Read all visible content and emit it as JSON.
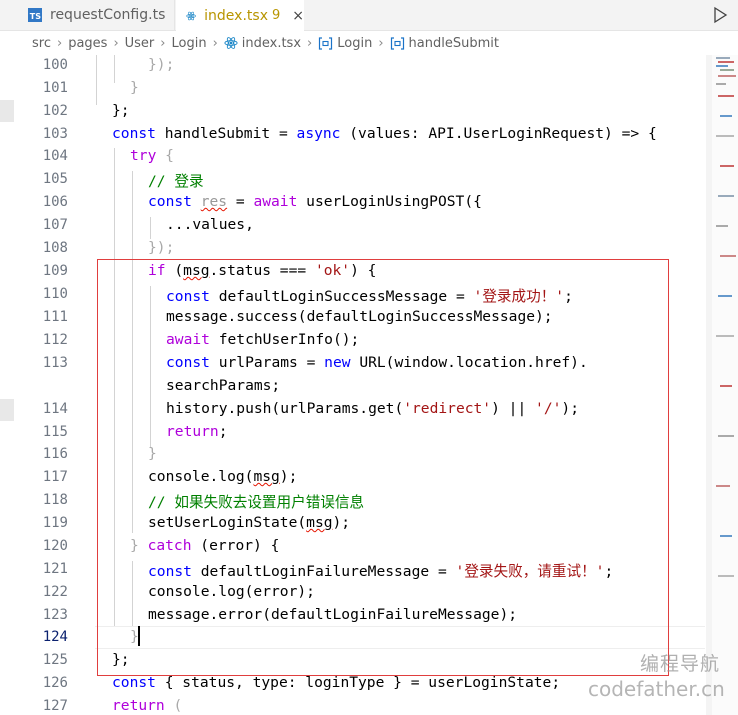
{
  "tabs": [
    {
      "label": "requestConfig.ts",
      "icon": "typescript-file-icon",
      "badge_text": "TS"
    },
    {
      "label": "index.tsx",
      "icon": "react-file-icon",
      "problem_count": "9",
      "close": "×"
    }
  ],
  "breadcrumb": [
    "src",
    "pages",
    "User",
    "Login",
    "index.tsx",
    "Login",
    "handleSubmit"
  ],
  "gutter": [
    "100",
    "101",
    "102",
    "103",
    "104",
    "105",
    "106",
    "107",
    "108",
    "109",
    "110",
    "111",
    "112",
    "113",
    "",
    "114",
    "115",
    "116",
    "117",
    "118",
    "119",
    "120",
    "121",
    "122",
    "123",
    "124",
    "125",
    "126",
    "127"
  ],
  "active_line": "124",
  "code": {
    "l100": "});",
    "l101": "}",
    "l102": "};",
    "l103_a": "const",
    "l103_b": " handleSubmit = ",
    "l103_c": "async",
    "l103_d": " (values: API.UserLoginRequest) => {",
    "l104_a": "try",
    "l104_b": " {",
    "l105": "// 登录",
    "l106_a": "const",
    "l106_b": "res",
    "l106_c": " = ",
    "l106_d": "await",
    "l106_e": " userLoginUsingPOST({",
    "l107": "...values,",
    "l108": "});",
    "l109_a": "if",
    "l109_b": " (",
    "l109_c": "msg",
    "l109_d": ".status === ",
    "l109_e": "'ok'",
    "l109_f": ") {",
    "l110_a": "const",
    "l110_b": " defaultLoginSuccessMessage = ",
    "l110_c": "'登录成功！'",
    "l110_d": ";",
    "l111": "message.success(defaultLoginSuccessMessage);",
    "l112_a": "await",
    "l112_b": " fetchUserInfo();",
    "l113_a": "const",
    "l113_b": " urlParams = ",
    "l113_c": "new",
    "l113_d": " URL(window.location.href).",
    "l113w": "searchParams;",
    "l114_a": "history.push(urlParams.get(",
    "l114_b": "'redirect'",
    "l114_c": ") || ",
    "l114_d": "'/'",
    "l114_e": ");",
    "l115_a": "return",
    "l115_b": ";",
    "l116": "}",
    "l117_a": "console.log(",
    "l117_b": "msg",
    "l117_c": ");",
    "l118": "// 如果失败去设置用户错误信息",
    "l119_a": "setUserLoginState(",
    "l119_b": "msg",
    "l119_c": ");",
    "l120_a": "} ",
    "l120_b": "catch",
    "l120_c": " (error) {",
    "l121_a": "const",
    "l121_b": " defaultLoginFailureMessage = ",
    "l121_c": "'登录失败，请重试！'",
    "l121_d": ";",
    "l122": "console.log(error);",
    "l123": "message.error(defaultLoginFailureMessage);",
    "l124": "}",
    "l125": "};",
    "l126_a": "const",
    "l126_b": " { status, type: loginType } = userLoginState;",
    "l127_a": "return",
    "l127_b": " ("
  },
  "watermark": {
    "cn": "编程导航",
    "en": "codefather.cn"
  },
  "colors": {
    "keyword": "#0000ff",
    "control": "#af00db",
    "string": "#a31515",
    "comment": "#008000",
    "highlight_box": "#e03e3e",
    "ts_badge": "#3178c6"
  }
}
